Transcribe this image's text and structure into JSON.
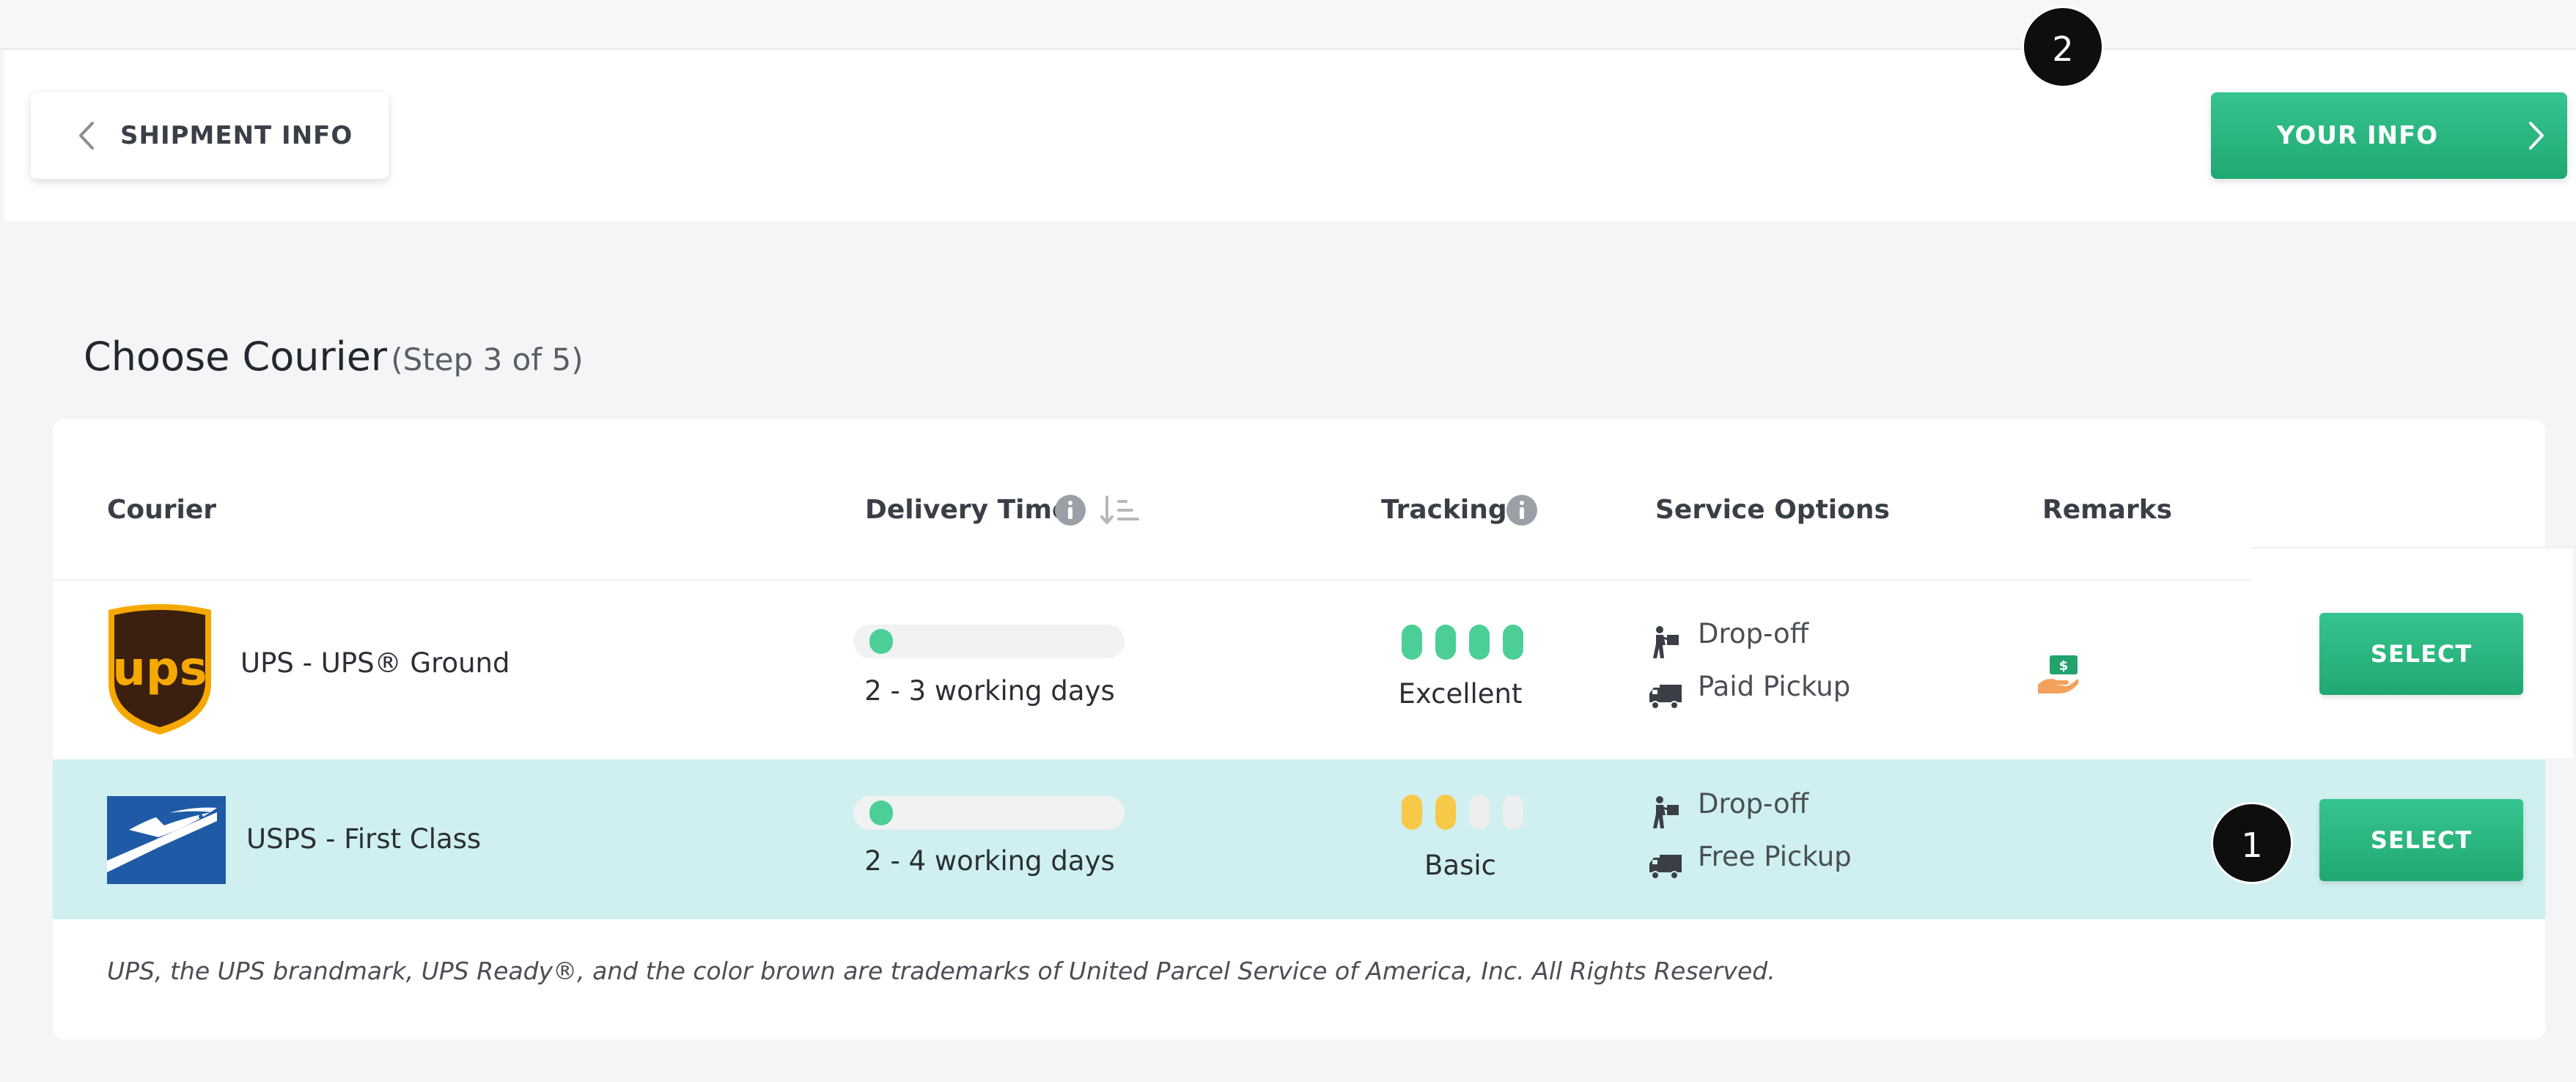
{
  "nav": {
    "back_label": "SHIPMENT INFO",
    "next_label": "YOUR INFO"
  },
  "markers": {
    "m1": "1",
    "m2": "2"
  },
  "page": {
    "title": "Choose Courier",
    "step": "(Step 3 of 5)"
  },
  "table": {
    "headers": {
      "courier": "Courier",
      "delivery_time": "Delivery Time",
      "tracking": "Tracking",
      "service_options": "Service Options",
      "remarks": "Remarks"
    },
    "rows": [
      {
        "courier": "UPS - UPS® Ground",
        "logo_text": "ups",
        "delivery_days": "2 - 3 working days",
        "delivery_fraction": 0.1,
        "tracking_level": 4,
        "tracking_max": 4,
        "tracking_label": "Excellent",
        "tracking_color": "#4ccf97",
        "service_options": [
          "Drop-off",
          "Paid Pickup"
        ],
        "remark_icon": "cash-in-hand-icon",
        "select_label": "SELECT"
      },
      {
        "courier": "USPS - First Class",
        "delivery_days": "2 - 4 working days",
        "delivery_fraction": 0.1,
        "tracking_level": 2,
        "tracking_max": 4,
        "tracking_label": "Basic",
        "tracking_color": "#f7c948",
        "service_options": [
          "Drop-off",
          "Free Pickup"
        ],
        "select_label": "SELECT"
      }
    ]
  },
  "disclaimer": "UPS, the UPS brandmark, UPS Ready®, and the color brown are trademarks of United Parcel Service of America, Inc. All Rights Reserved.",
  "colors": {
    "accent_green": "#2bb57e",
    "highlight_row": "#cfeff0",
    "pill_empty": "#eceeef",
    "ups_brown": "#3b1f0f",
    "ups_gold": "#f5a900",
    "usps_blue": "#1f5aa6"
  }
}
